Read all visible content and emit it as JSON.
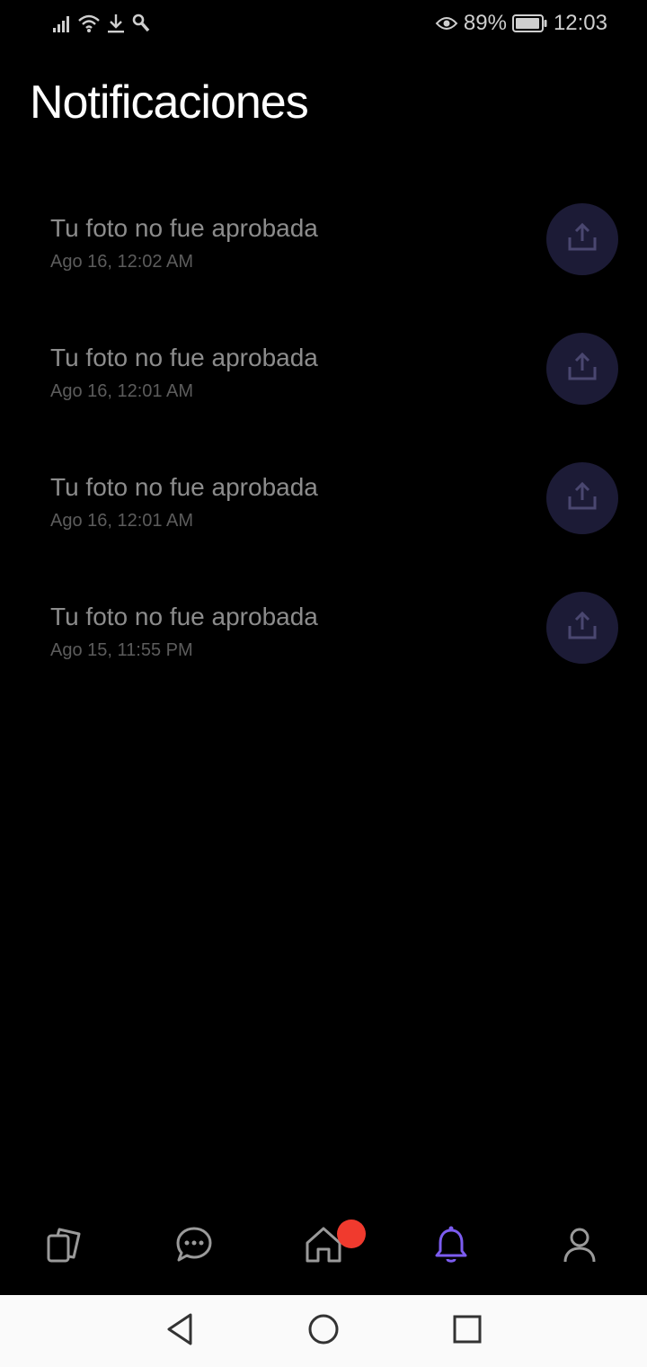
{
  "status_bar": {
    "battery_percent": "89%",
    "time": "12:03",
    "icons": [
      "signal-icon",
      "wifi-icon",
      "download-icon",
      "wrench-icon",
      "eye-comfort-icon",
      "battery-icon"
    ]
  },
  "page": {
    "title": "Notificaciones"
  },
  "notifications": [
    {
      "title": "Tu foto no fue aprobada",
      "time": "Ago 16, 12:02 AM",
      "icon": "upload-icon"
    },
    {
      "title": "Tu foto no fue aprobada",
      "time": "Ago 16, 12:01 AM",
      "icon": "upload-icon"
    },
    {
      "title": "Tu foto no fue aprobada",
      "time": "Ago 16, 12:01 AM",
      "icon": "upload-icon"
    },
    {
      "title": "Tu foto no fue aprobada",
      "time": "Ago 15, 11:55 PM",
      "icon": "upload-icon"
    }
  ],
  "bottom_nav": {
    "items": [
      {
        "icon": "cards-icon",
        "active": false
      },
      {
        "icon": "chat-icon",
        "active": false
      },
      {
        "icon": "home-icon",
        "active": false,
        "badge": true
      },
      {
        "icon": "bell-icon",
        "active": true
      },
      {
        "icon": "profile-icon",
        "active": false
      }
    ],
    "active_color": "#7c5cf0",
    "inactive_color": "#9a9a9a",
    "badge_color": "#f03a2e"
  },
  "system_nav": {
    "icons": [
      "back-icon",
      "home-circle-icon",
      "recents-icon"
    ]
  }
}
